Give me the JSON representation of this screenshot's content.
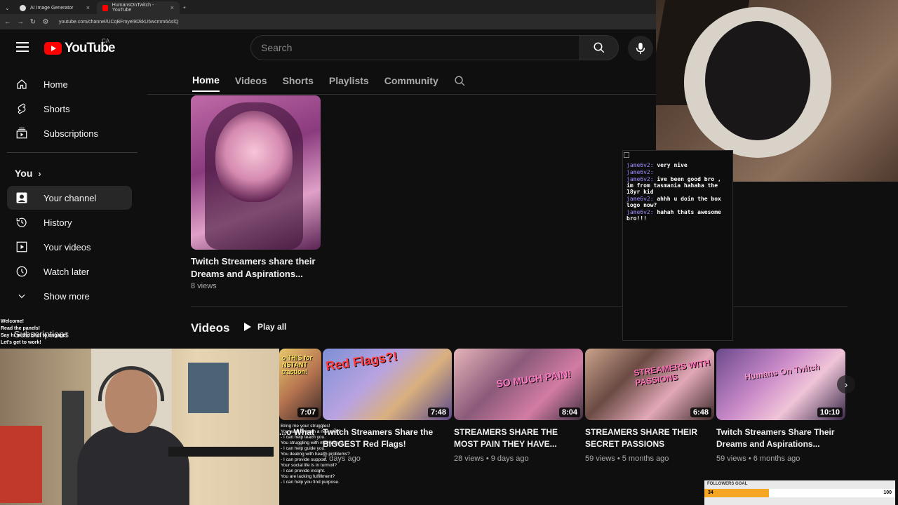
{
  "browser": {
    "tabs": [
      {
        "label": "AI Image Generator",
        "active": false
      },
      {
        "label": "HumansOnTwitch - YouTube",
        "active": true
      }
    ],
    "url": "youtube.com/channel/UCqBFmyel9DkkU5wcmm6AslQ"
  },
  "header": {
    "logo_text": "YouTube",
    "country": "CA",
    "search_placeholder": "Search"
  },
  "sidebar": {
    "top_items": [
      {
        "label": "Home",
        "icon": "home-icon"
      },
      {
        "label": "Shorts",
        "icon": "shorts-icon"
      },
      {
        "label": "Subscriptions",
        "icon": "subscriptions-icon"
      }
    ],
    "you_label": "You",
    "you_items": [
      {
        "label": "Your channel",
        "icon": "user-icon",
        "active": true
      },
      {
        "label": "History",
        "icon": "history-icon"
      },
      {
        "label": "Your videos",
        "icon": "play-square-icon"
      },
      {
        "label": "Watch later",
        "icon": "clock-icon"
      },
      {
        "label": "Show more",
        "icon": "chevron-down-icon"
      }
    ],
    "subscriptions_label": "Subscriptions"
  },
  "channel_tabs": [
    "Home",
    "Videos",
    "Shorts",
    "Playlists",
    "Community"
  ],
  "featured_short": {
    "title": "Twitch Streamers share their Dreams and Aspirations...",
    "views": "8 views"
  },
  "videos_section": {
    "title": "Videos",
    "play_all": "Play all",
    "items": [
      {
        "title": "...o What",
        "meta": "",
        "duration": "7:07",
        "overlay": "o THIS for NSTANT traction!"
      },
      {
        "title": "Twitch Streamers Share the BIGGEST Red Flags!",
        "meta": "7 days ago",
        "duration": "7:48",
        "overlay": "Red Flags?!"
      },
      {
        "title": "STREAMERS SHARE THE MOST PAIN THEY HAVE...",
        "meta": "28 views • 9 days ago",
        "duration": "8:04",
        "overlay": "SO MUCH PAIN!"
      },
      {
        "title": "STREAMERS SHARE THEIR SECRET PASSIONS",
        "meta": "59 views • 5 months ago",
        "duration": "6:48",
        "overlay": "STREAMERS WITH PASSIONS"
      },
      {
        "title": "Twitch Streamers Share Their Dreams and Aspirations...",
        "meta": "59 views • 6 months ago",
        "duration": "10:10",
        "overlay": "Humans On Twitch"
      }
    ]
  },
  "chat": {
    "messages": [
      {
        "user": "jame6v2:",
        "text": "very nive"
      },
      {
        "user": "jame6v2:",
        "text": ""
      },
      {
        "user": "jame6v2:",
        "text": "ive been good bro , im from tasmania hahaha the 18yr kid"
      },
      {
        "user": "jame6v2:",
        "text": "ahhh u doin the box logo now?"
      },
      {
        "user": "jame6v2:",
        "text": "hahah thats awesome bro!!!"
      }
    ]
  },
  "welcome_overlay": [
    "Welcome!",
    "Read the panels!",
    "Say hi in the chat to engage!",
    "Let's get to work!"
  ],
  "bot_panel": [
    "Bring me your struggles!",
    "You want to learn a new skill?",
    "- I can help teach you.",
    "You struggling with motivation?",
    "- I can help guide you.",
    "You dealing with health problems?",
    "- I can provide support.",
    "Your social life is in turmoil?",
    "- I can provide insight.",
    "You are lacking fulfillment?",
    "- I can help you find purpose."
  ],
  "followers_goal": {
    "label": "FOLLOWERS GOAL",
    "current": "34",
    "max": "100",
    "progress": 0.34
  },
  "colors": {
    "brand_red": "#ff0000",
    "goal_fill": "#f5a623",
    "chat_user": "#9b8cff"
  }
}
